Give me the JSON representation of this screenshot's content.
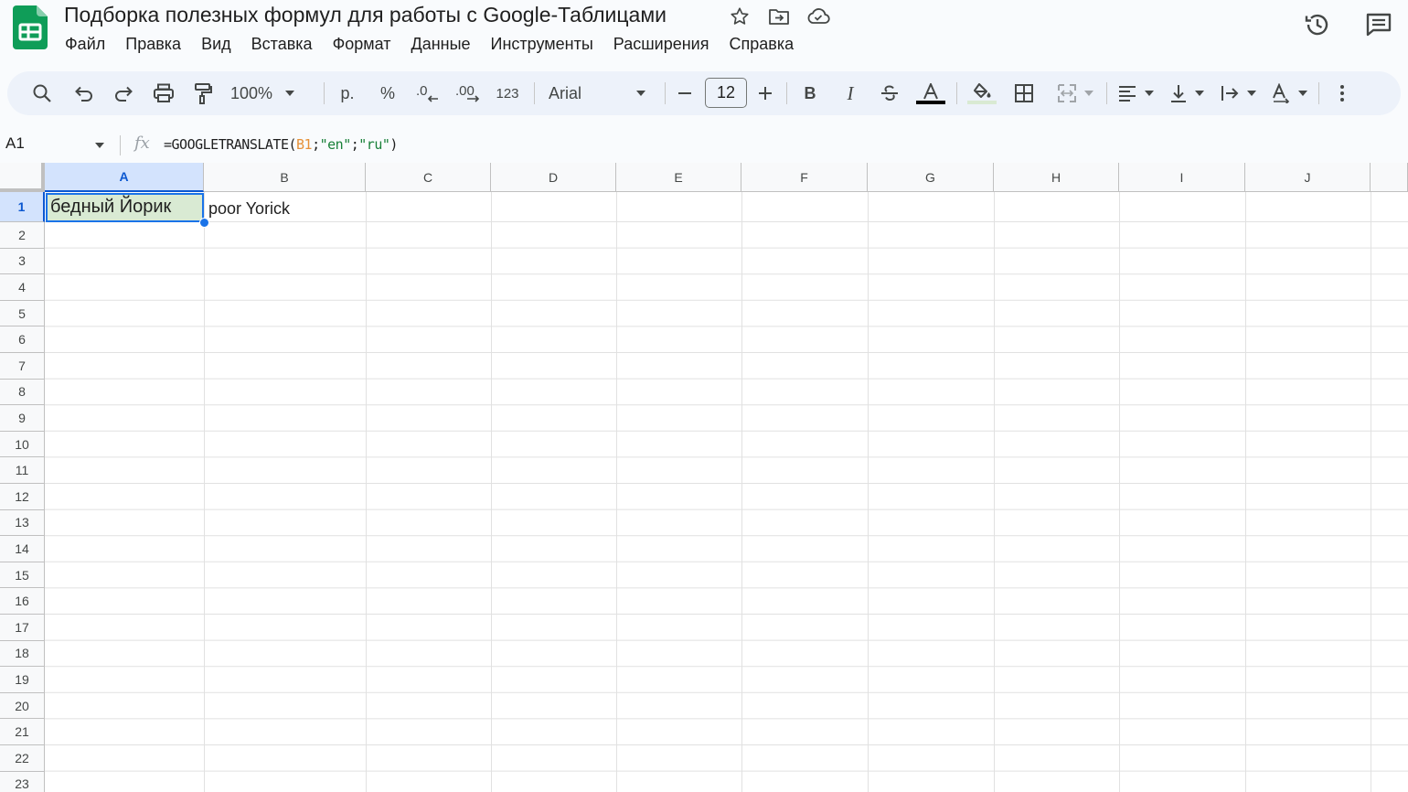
{
  "header": {
    "doc_title": "Подборка полезных формул для работы с Google-Таблицами",
    "menu": [
      "Файл",
      "Правка",
      "Вид",
      "Вставка",
      "Формат",
      "Данные",
      "Инструменты",
      "Расширения",
      "Справка"
    ]
  },
  "toolbar": {
    "zoom": "100%",
    "currency": "р.",
    "percent": "%",
    "format_more": "123",
    "font_family": "Arial",
    "font_size": "12",
    "bold": "B",
    "italic": "I"
  },
  "formula_bar": {
    "name_box": "A1",
    "fx": "fx",
    "formula_prefix": "=GOOGLETRANSLATE(",
    "formula_ref": "B1",
    "formula_sep1": ";",
    "formula_str1": "\"en\"",
    "formula_sep2": ";",
    "formula_str2": "\"ru\"",
    "formula_suffix": ")"
  },
  "grid": {
    "columns": [
      "A",
      "B",
      "C",
      "D",
      "E",
      "F",
      "G",
      "H",
      "I",
      "J"
    ],
    "rows": [
      "1",
      "2",
      "3",
      "4",
      "5",
      "6",
      "7",
      "8",
      "9",
      "10",
      "11",
      "12",
      "13",
      "14",
      "15",
      "16",
      "17",
      "18",
      "19",
      "20",
      "21",
      "22",
      "23"
    ],
    "selected_cell": "A1",
    "cells": {
      "A1": "бедный Йорик",
      "B1": "poor Yorick"
    }
  },
  "colors": {
    "sheets_green": "#0f9d58",
    "selection_blue": "#1a73e8",
    "a1_fill": "#d9ead3",
    "formula_ref_orange": "#e69138",
    "formula_string_green": "#188038"
  }
}
